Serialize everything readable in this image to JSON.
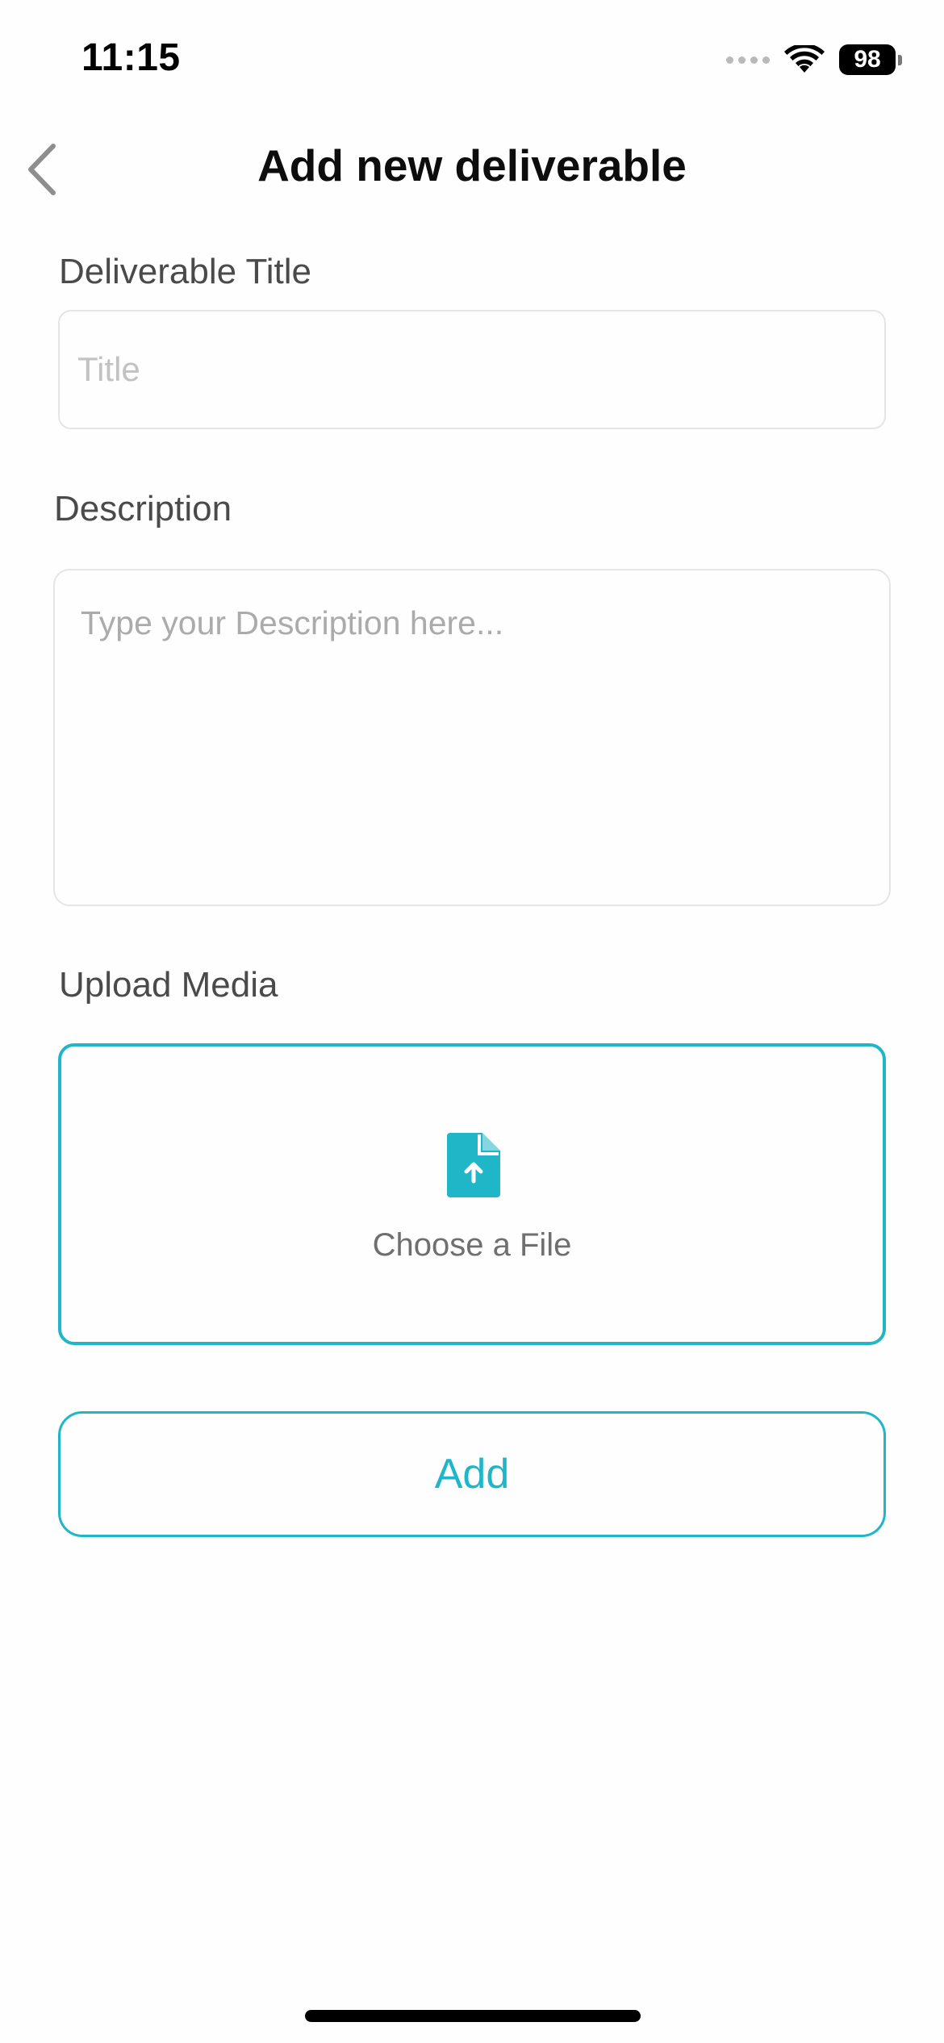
{
  "status_bar": {
    "time": "11:15",
    "battery": "98"
  },
  "header": {
    "title": "Add new deliverable"
  },
  "form": {
    "title_label": "Deliverable Title",
    "title_placeholder": "Title",
    "description_label": "Description",
    "description_placeholder": "Type your Description here...",
    "upload_label": "Upload Media",
    "upload_text": "Choose a File"
  },
  "actions": {
    "add_label": "Add"
  },
  "colors": {
    "accent": "#1fb6c8",
    "label": "#4a4a4a",
    "placeholder": "#c2c2c2",
    "border": "#e5e5e5"
  },
  "icons": {
    "back": "chevron-left-icon",
    "upload": "file-upload-icon",
    "wifi": "wifi-icon",
    "signal": "signal-icon",
    "battery": "battery-icon"
  }
}
